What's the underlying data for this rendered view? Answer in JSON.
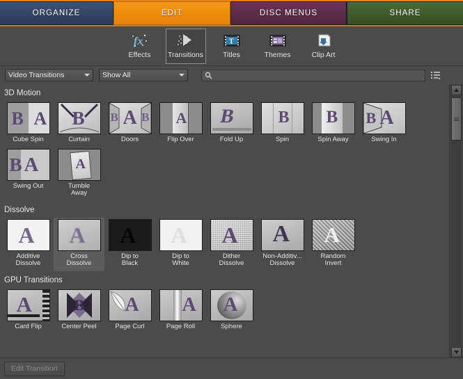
{
  "tabs": [
    {
      "label": "ORGANIZE",
      "key": "organize",
      "active": false
    },
    {
      "label": "EDIT",
      "key": "edit",
      "active": true
    },
    {
      "label": "DISC MENUS",
      "key": "disc-menus",
      "active": false
    },
    {
      "label": "SHARE",
      "key": "share",
      "active": false
    }
  ],
  "toolbar": {
    "items": [
      {
        "label": "Effects",
        "icon": "effects-fx-icon",
        "selected": false
      },
      {
        "label": "Transitions",
        "icon": "transitions-arrow-icon",
        "selected": true
      },
      {
        "label": "Titles",
        "icon": "titles-filmstrip-t-icon",
        "selected": false
      },
      {
        "label": "Themes",
        "icon": "themes-filmstrip-icon",
        "selected": false
      },
      {
        "label": "Clip Art",
        "icon": "clip-art-page-icon",
        "selected": false
      }
    ]
  },
  "filters": {
    "category_value": "Video Transitions",
    "show_value": "Show All",
    "search_placeholder": "",
    "search_value": "",
    "search_icon": "magnifier-icon",
    "list_view_icon": "list-view-icon"
  },
  "groups": [
    {
      "title": "3D Motion",
      "items": [
        {
          "label": "Cube Spin",
          "art": "cube-spin",
          "selected": false
        },
        {
          "label": "Curtain",
          "art": "curtain",
          "selected": false
        },
        {
          "label": "Doors",
          "art": "doors",
          "selected": false
        },
        {
          "label": "Flip Over",
          "art": "flip-over",
          "selected": false
        },
        {
          "label": "Fold Up",
          "art": "fold-up",
          "selected": false
        },
        {
          "label": "Spin",
          "art": "spin",
          "selected": false
        },
        {
          "label": "Spin Away",
          "art": "spin-away",
          "selected": false
        },
        {
          "label": "Swing In",
          "art": "swing-in",
          "selected": false
        },
        {
          "label": "Swing Out",
          "art": "swing-out",
          "selected": false
        },
        {
          "label": "Tumble\nAway",
          "art": "tumble-away",
          "selected": false
        }
      ]
    },
    {
      "title": "Dissolve",
      "items": [
        {
          "label": "Additive\nDissolve",
          "art": "additive-dissolve",
          "selected": false
        },
        {
          "label": "Cross\nDissolve",
          "art": "cross-dissolve",
          "selected": true
        },
        {
          "label": "Dip to\nBlack",
          "art": "dip-to-black",
          "selected": false
        },
        {
          "label": "Dip to\nWhite",
          "art": "dip-to-white",
          "selected": false
        },
        {
          "label": "Dither\nDissolve",
          "art": "dither-dissolve",
          "selected": false
        },
        {
          "label": "Non-Additiv...\nDissolve",
          "art": "non-additive-dissolve",
          "selected": false
        },
        {
          "label": "Random\nInvert",
          "art": "random-invert",
          "selected": false
        }
      ]
    },
    {
      "title": "GPU Transitions",
      "items": [
        {
          "label": "Card Flip",
          "art": "card-flip",
          "selected": false
        },
        {
          "label": "Center Peel",
          "art": "center-peel",
          "selected": false
        },
        {
          "label": "Page Curl",
          "art": "page-curl",
          "selected": false
        },
        {
          "label": "Page Roll",
          "art": "page-roll",
          "selected": false
        },
        {
          "label": "Sphere",
          "art": "sphere",
          "selected": false
        }
      ]
    }
  ],
  "scrollbar": {
    "up_icon": "scroll-up-arrow-icon",
    "down_icon": "scroll-down-arrow-icon",
    "thumb_top_pct": 5,
    "thumb_height_pct": 16
  },
  "bottom": {
    "edit_transition_label": "Edit Transition",
    "edit_transition_enabled": false
  },
  "colors": {
    "accent_orange": "#e8820c",
    "panel_bg": "#4b4b4b",
    "tab_organize": "#334563",
    "tab_disc": "#5c2c47",
    "tab_share": "#3e5a2c",
    "letter_purple": "#5b4a72"
  }
}
